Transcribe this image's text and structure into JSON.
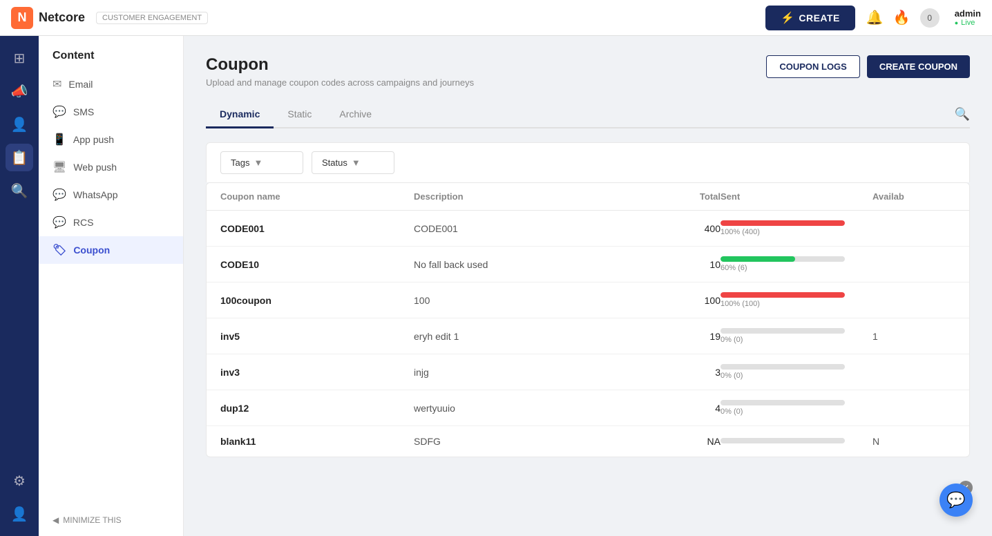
{
  "topnav": {
    "logo_letter": "N",
    "logo_name": "Netcore",
    "product_name": "CUSTOMER ENGAGEMENT",
    "create_label": "CREATE",
    "admin_name": "admin",
    "admin_status": "Live"
  },
  "icon_sidebar": {
    "items": [
      {
        "name": "grid-icon",
        "icon": "⊞",
        "active": false
      },
      {
        "name": "megaphone-icon",
        "icon": "📣",
        "active": false
      },
      {
        "name": "people-icon",
        "icon": "👤",
        "active": false
      },
      {
        "name": "calendar-icon",
        "icon": "📅",
        "active": true
      },
      {
        "name": "analytics-icon",
        "icon": "🔍",
        "active": false
      }
    ],
    "bottom_items": [
      {
        "name": "settings-icon",
        "icon": "⚙",
        "active": false
      },
      {
        "name": "user-icon",
        "icon": "👤",
        "active": false
      }
    ]
  },
  "nav_sidebar": {
    "title": "Content",
    "items": [
      {
        "label": "Email",
        "icon": "✉",
        "active": false
      },
      {
        "label": "SMS",
        "icon": "💬",
        "active": false
      },
      {
        "label": "App push",
        "icon": "📱",
        "active": false
      },
      {
        "label": "Web push",
        "icon": "🖥",
        "active": false
      },
      {
        "label": "WhatsApp",
        "icon": "💬",
        "active": false
      },
      {
        "label": "RCS",
        "icon": "💬",
        "active": false
      },
      {
        "label": "Coupon",
        "icon": "🏷",
        "active": true
      }
    ],
    "minimize_label": "MINIMIZE THIS"
  },
  "page": {
    "title": "Coupon",
    "subtitle": "Upload and manage coupon codes across campaigns and journeys",
    "coupon_logs_btn": "COUPON LOGS",
    "create_coupon_btn": "CREATE COUPON"
  },
  "tabs": [
    {
      "label": "Dynamic",
      "active": true
    },
    {
      "label": "Static",
      "active": false
    },
    {
      "label": "Archive",
      "active": false
    }
  ],
  "filters": {
    "tags_label": "Tags",
    "status_label": "Status"
  },
  "table": {
    "columns": [
      "Coupon name",
      "Description",
      "Total",
      "Sent",
      "Availab"
    ],
    "rows": [
      {
        "name": "CODE001",
        "description": "CODE001",
        "total": "400",
        "sent_pct": 100,
        "sent_label": "100% (400)",
        "sent_color": "#ef4444",
        "avail": ""
      },
      {
        "name": "CODE10",
        "description": "No fall back used",
        "total": "10",
        "sent_pct": 60,
        "sent_label": "60% (6)",
        "sent_color": "#22c55e",
        "avail": ""
      },
      {
        "name": "100coupon",
        "description": "100",
        "total": "100",
        "sent_pct": 100,
        "sent_label": "100% (100)",
        "sent_color": "#ef4444",
        "avail": ""
      },
      {
        "name": "inv5",
        "description": "eryh edit 1",
        "total": "19",
        "sent_pct": 0,
        "sent_label": "0% (0)",
        "sent_color": "#e0e0e0",
        "avail": "1"
      },
      {
        "name": "inv3",
        "description": "injg",
        "total": "3",
        "sent_pct": 0,
        "sent_label": "0% (0)",
        "sent_color": "#e0e0e0",
        "avail": ""
      },
      {
        "name": "dup12",
        "description": "wertyuuio",
        "total": "4",
        "sent_pct": 0,
        "sent_label": "0% (0)",
        "sent_color": "#e0e0e0",
        "avail": ""
      },
      {
        "name": "blank11",
        "description": "SDFG",
        "total": "NA",
        "sent_pct": 0,
        "sent_label": "",
        "sent_color": "#e0e0e0",
        "avail": "N"
      }
    ]
  }
}
